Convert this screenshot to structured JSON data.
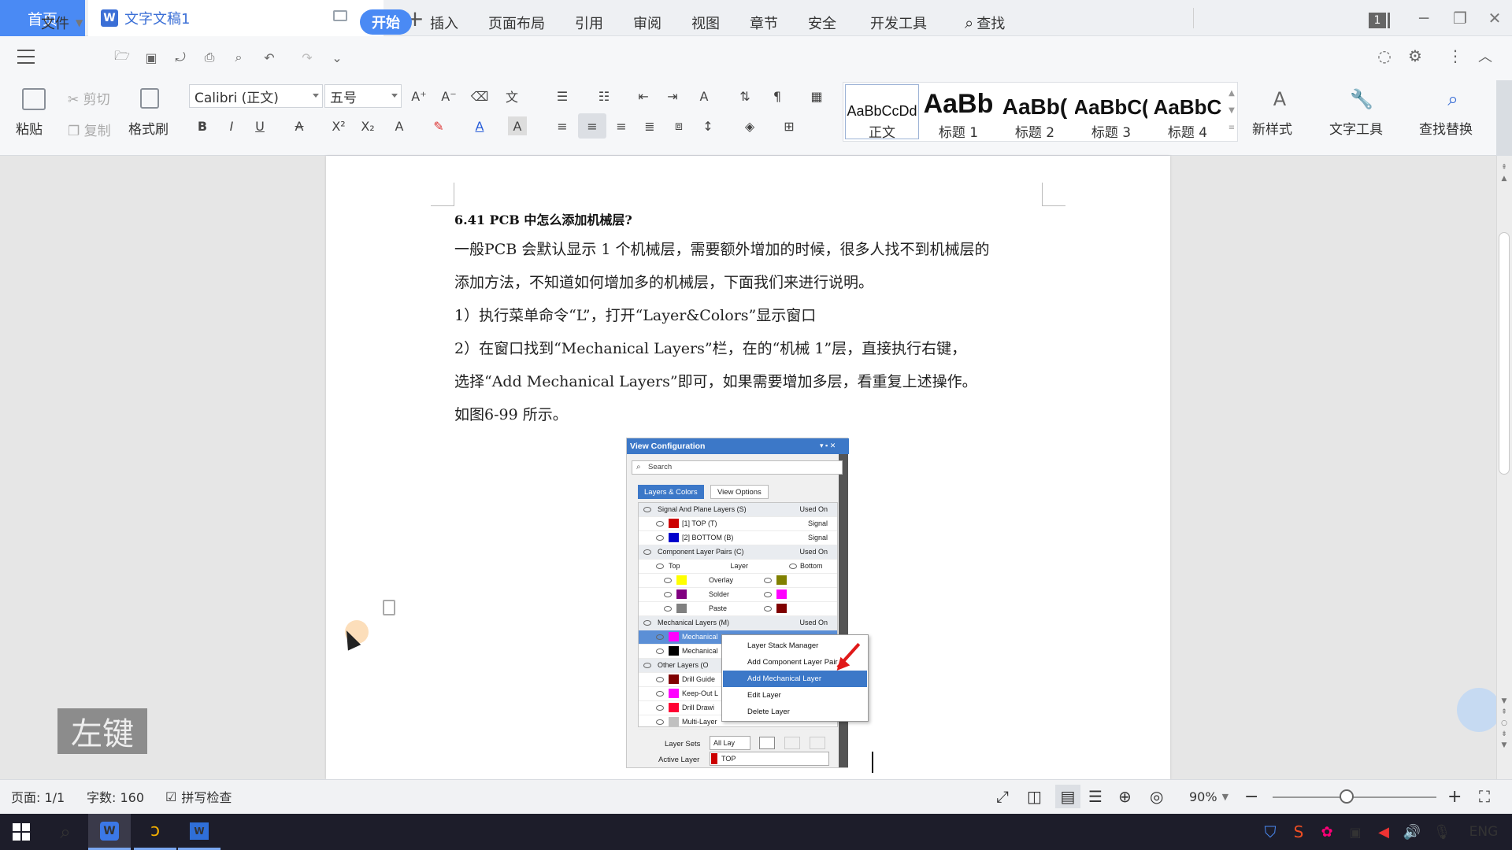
{
  "titlebar": {
    "home_tab": "首页",
    "doc_tab": "文字文稿1",
    "doc_icon": "W",
    "add_tab": "+",
    "window_badge": "1"
  },
  "menu": {
    "file": "文件",
    "items": [
      "开始",
      "插入",
      "页面布局",
      "引用",
      "审阅",
      "视图",
      "章节",
      "安全",
      "开发工具"
    ],
    "search": "查找"
  },
  "ribbon": {
    "paste": "粘贴",
    "cut": "剪切",
    "copy": "复制",
    "format_painter": "格式刷",
    "font_name": "Calibri (正文)",
    "font_size": "五号",
    "styles": [
      {
        "preview": "AaBbCcDd",
        "name": "正文"
      },
      {
        "preview": "AaBb",
        "name": "标题 1"
      },
      {
        "preview": "AaBb(",
        "name": "标题 2"
      },
      {
        "preview": "AaBbC(",
        "name": "标题 3"
      },
      {
        "preview": "AaBbC",
        "name": "标题 4"
      }
    ],
    "new_style": "新样式",
    "text_tools": "文字工具",
    "find_replace": "查找替换"
  },
  "document": {
    "heading": "6.41 PCB 中怎么添加机械层?",
    "paragraphs": [
      "一般PCB 会默认显示 1 个机械层，需要额外增加的时候，很多人找不到机械层的",
      "添加方法，不知道如何增加多的机械层，下面我们来进行说明。",
      "1）执行菜单命令“L”，打开“Layer&Colors”显示窗口",
      "2）在窗口找到“Mechanical Layers”栏，在的“机械 1”层，直接执行右键，",
      "选择“Add Mechanical Layers”即可，如果需要增加多层，看重复上述操作。",
      "如图6-99 所示。"
    ]
  },
  "embedded_screenshot": {
    "title": "View Configuration",
    "search_placeholder": "Search",
    "tabs": [
      "Layers & Colors",
      "View Options"
    ],
    "groups": [
      {
        "label": "Signal And Plane Layers (S)",
        "col": "Used On"
      },
      {
        "label": "Component Layer Pairs (C)",
        "col": "Used On"
      },
      {
        "label": "Mechanical Layers (M)",
        "col": "Used On"
      },
      {
        "label": "Other Layers (O"
      }
    ],
    "signal_rows": [
      {
        "label": "[1] TOP (T)",
        "type": "Signal",
        "color": "#cc0000"
      },
      {
        "label": "[2] BOTTOM (B)",
        "type": "Signal",
        "color": "#0000cc"
      }
    ],
    "pair_header": {
      "top": "Top",
      "layer": "Layer",
      "bottom": "Bottom"
    },
    "pair_rows": [
      {
        "label": "Overlay",
        "top_color": "#ffff00",
        "bottom_color": "#808000"
      },
      {
        "label": "Solder",
        "top_color": "#800080",
        "bottom_color": "#ff00ff"
      },
      {
        "label": "Paste",
        "top_color": "#808080",
        "bottom_color": "#800000"
      }
    ],
    "mech_rows": [
      {
        "label": "Mechanical",
        "color": "#ff00ff"
      },
      {
        "label": "Mechanical",
        "color": "#000000"
      }
    ],
    "other_rows": [
      {
        "label": "Drill Guide",
        "color": "#800000"
      },
      {
        "label": "Keep-Out L",
        "color": "#ff00ff"
      },
      {
        "label": "Drill Drawi",
        "color": "#ff0033"
      },
      {
        "label": "Multi-Layer",
        "color": "#c0c0c0"
      }
    ],
    "layer_sets_label": "Layer Sets",
    "layer_sets_value": "All Lay",
    "active_layer_label": "Active Layer",
    "active_layer_value": "TOP",
    "context_menu": [
      "Layer Stack Manager",
      "Add Component Layer Pair",
      "Add Mechanical Layer",
      "Edit Layer",
      "Delete Layer"
    ]
  },
  "key_hint": "左键",
  "status": {
    "page": "页面: 1/1",
    "word_count": "字数: 160",
    "spell_check": "拼写检查",
    "zoom": "90%",
    "zoom_level": 0.45
  },
  "taskbar": {
    "lang": "ENG"
  }
}
